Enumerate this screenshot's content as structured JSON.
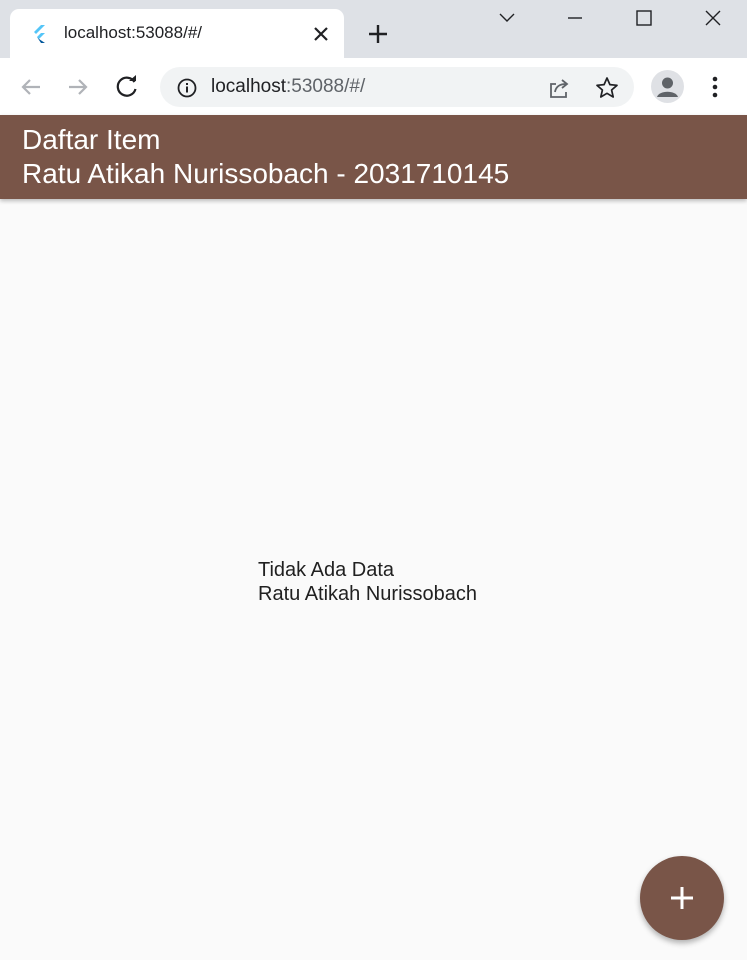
{
  "browser": {
    "tab": {
      "title": "localhost:53088/#/",
      "favicon": "flutter-icon"
    },
    "address_bar": {
      "host": "localhost",
      "rest": ":53088/#/"
    },
    "icons": {
      "back": "back-arrow-icon",
      "forward": "forward-arrow-icon",
      "reload": "reload-icon",
      "info": "info-icon",
      "share": "share-icon",
      "bookmark": "star-icon",
      "profile": "profile-icon",
      "menu": "kebab-menu-icon",
      "new_tab": "plus-icon",
      "minimize": "minimize-icon",
      "maximize": "maximize-icon",
      "close_window": "close-icon",
      "tab_search": "chevron-down-icon"
    }
  },
  "app": {
    "appbar": {
      "title_line1": "Daftar Item",
      "title_line2": "Ratu Atikah Nurissobach - 2031710145",
      "color": "#795548"
    },
    "empty_state": {
      "line1": "Tidak Ada Data",
      "line2": "Ratu Atikah Nurissobach"
    },
    "fab": {
      "icon": "add-icon",
      "color": "#795548"
    }
  }
}
